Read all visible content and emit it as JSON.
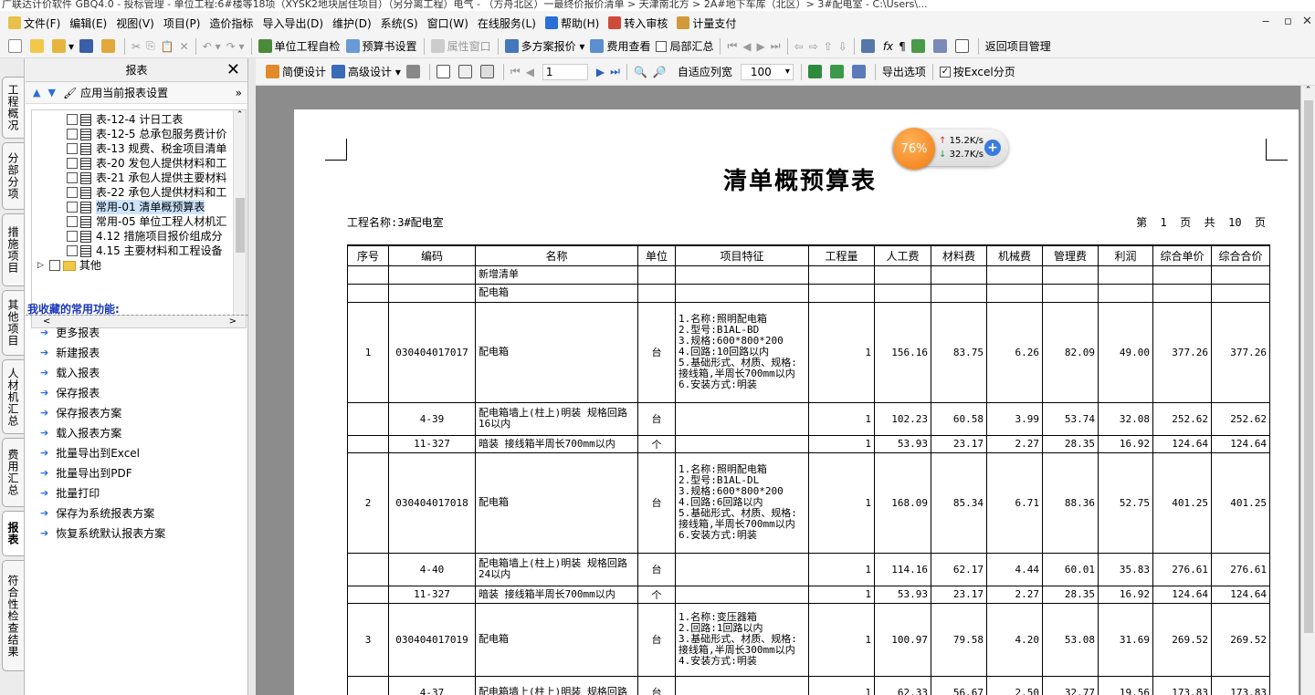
{
  "window": {
    "title": "广联达计价软件 GBQ4.0 - 投标管理 - 单位工程:6#楼等18项（XYSK2地块居住项目）（另分离工程）电气 - （方舟北区）一最终价报价清单 > 天津南北方 > 2A#地下车库（北区）> 3#配电室 - C:\\Users\\..."
  },
  "menu": {
    "items": [
      "文件(F)",
      "编辑(E)",
      "视图(V)",
      "项目(P)",
      "造价指标",
      "导入导出(D)",
      "维护(D)",
      "系统(S)",
      "窗口(W)",
      "在线服务(L)",
      "帮助(H)",
      "转入审核",
      "计量支付"
    ]
  },
  "toolbar1": {
    "unit_check": "单位工程自检",
    "budget_setting": "预算书设置",
    "property_window": "属性窗口",
    "multi_scheme": "多方案报价",
    "fee_view": "费用查看",
    "local_summary": "局部汇总",
    "return_project": "返回项目管理"
  },
  "left_tabs": [
    "工程概况",
    "分部分项",
    "措施项目",
    "其他项目",
    "人材机汇总",
    "费用汇总",
    "报表",
    "符合性检查结果"
  ],
  "panel": {
    "title": "报表",
    "apply_current": "应用当前报表设置",
    "tree_items": [
      {
        "label": "表-12-4 计日工表",
        "selected": false
      },
      {
        "label": "表-12-5 总承包服务费计价",
        "selected": false
      },
      {
        "label": "表-13 规费、税金项目清单",
        "selected": false
      },
      {
        "label": "表-20 发包人提供材料和工",
        "selected": false
      },
      {
        "label": "表-21 承包人提供主要材料",
        "selected": false
      },
      {
        "label": "表-22 承包人提供材料和工",
        "selected": false
      },
      {
        "label": "常用-01 清单概预算表",
        "selected": true
      },
      {
        "label": "常用-05 单位工程人材机汇",
        "selected": false
      },
      {
        "label": "4.12 措施项目报价组成分",
        "selected": false
      },
      {
        "label": "4.15 主要材料和工程设备",
        "selected": false
      }
    ],
    "folder_other": "其他",
    "fav_title": "我收藏的常用功能:",
    "fav_items": [
      "更多报表",
      "新建报表",
      "载入报表",
      "保存报表",
      "保存报表方案",
      "载入报表方案",
      "批量导出到Excel",
      "批量导出到PDF",
      "批量打印",
      "保存为系统报表方案",
      "恢复系统默认报表方案"
    ]
  },
  "toolbar2": {
    "simple_design": "简便设计",
    "advanced_design": "高级设计",
    "page_value": "1",
    "fit_width": "自适应列宽",
    "zoom": "100",
    "export_options": "导出选项",
    "excel_paging": "按Excel分页"
  },
  "report": {
    "title": "清单概预算表",
    "project_label": "工程名称:3#配电室",
    "page_info": "第  1  页  共  10  页",
    "headers": [
      "序号",
      "编码",
      "名称",
      "单位",
      "项目特征",
      "工程量",
      "人工费",
      "材料费",
      "机械费",
      "管理费",
      "利润",
      "综合单价",
      "综合合价"
    ],
    "rows": [
      {
        "seq": "",
        "code": "",
        "name": "新增清单",
        "unit": "",
        "feat": "",
        "qty": "",
        "labor": "",
        "mat": "",
        "mach": "",
        "mgmt": "",
        "profit": "",
        "uprice": "",
        "total": "",
        "h": 20
      },
      {
        "seq": "",
        "code": "",
        "name": "配电箱",
        "unit": "",
        "feat": "",
        "qty": "",
        "labor": "",
        "mat": "",
        "mach": "",
        "mgmt": "",
        "profit": "",
        "uprice": "",
        "total": "",
        "h": 20
      },
      {
        "seq": "1",
        "code": "030404017017",
        "name": "配电箱",
        "unit": "台",
        "feat": "1.名称:照明配电箱\n2.型号:B1AL-BD\n3.规格:600*800*200\n4.回路:10回路以内\n5.基础形式、材质、规格:\n接线箱,半周长700mm以内\n6.安装方式:明装",
        "qty": "1",
        "labor": "156.16",
        "mat": "83.75",
        "mach": "6.26",
        "mgmt": "82.09",
        "profit": "49.00",
        "uprice": "377.26",
        "total": "377.26",
        "h": 110
      },
      {
        "seq": "",
        "code": "4-39",
        "name": "配电箱墙上(柱上)明装 规格回路16以内",
        "unit": "台",
        "feat": "",
        "qty": "1",
        "labor": "102.23",
        "mat": "60.58",
        "mach": "3.99",
        "mgmt": "53.74",
        "profit": "32.08",
        "uprice": "252.62",
        "total": "252.62",
        "h": 36
      },
      {
        "seq": "",
        "code": "11-327",
        "name": "暗装 接线箱半周长700mm以内",
        "unit": "个",
        "feat": "",
        "qty": "1",
        "labor": "53.93",
        "mat": "23.17",
        "mach": "2.27",
        "mgmt": "28.35",
        "profit": "16.92",
        "uprice": "124.64",
        "total": "124.64",
        "h": 19
      },
      {
        "seq": "2",
        "code": "030404017018",
        "name": "配电箱",
        "unit": "台",
        "feat": "1.名称:照明配电箱\n2.型号:B1AL-DL\n3.规格:600*800*200\n4.回路:6回路以内\n5.基础形式、材质、规格:\n接线箱,半周长700mm以内\n6.安装方式:明装",
        "qty": "1",
        "labor": "168.09",
        "mat": "85.34",
        "mach": "6.71",
        "mgmt": "88.36",
        "profit": "52.75",
        "uprice": "401.25",
        "total": "401.25",
        "h": 110
      },
      {
        "seq": "",
        "code": "4-40",
        "name": "配电箱墙上(柱上)明装 规格回路24以内",
        "unit": "台",
        "feat": "",
        "qty": "1",
        "labor": "114.16",
        "mat": "62.17",
        "mach": "4.44",
        "mgmt": "60.01",
        "profit": "35.83",
        "uprice": "276.61",
        "total": "276.61",
        "h": 36
      },
      {
        "seq": "",
        "code": "11-327",
        "name": "暗装 接线箱半周长700mm以内",
        "unit": "个",
        "feat": "",
        "qty": "1",
        "labor": "53.93",
        "mat": "23.17",
        "mach": "2.27",
        "mgmt": "28.35",
        "profit": "16.92",
        "uprice": "124.64",
        "total": "124.64",
        "h": 19
      },
      {
        "seq": "3",
        "code": "030404017019",
        "name": "配电箱",
        "unit": "台",
        "feat": "1.名称:变压器箱\n2.回路:1回路以内\n3.基础形式、材质、规格:\n接线箱,半周长300mm以内\n4.安装方式:明装",
        "qty": "1",
        "labor": "100.97",
        "mat": "79.58",
        "mach": "4.20",
        "mgmt": "53.08",
        "profit": "31.69",
        "uprice": "269.52",
        "total": "269.52",
        "h": 80
      },
      {
        "seq": "",
        "code": "4-37",
        "name": "配电箱墙上(柱上)明装 规格回路",
        "unit": "台",
        "feat": "",
        "qty": "1",
        "labor": "62.33",
        "mat": "56.67",
        "mach": "2.50",
        "mgmt": "32.77",
        "profit": "19.56",
        "uprice": "173.83",
        "total": "173.83",
        "h": 36
      }
    ]
  },
  "speed_widget": {
    "percent": "76%",
    "up": "15.2K/s",
    "down": "32.7K/s"
  }
}
